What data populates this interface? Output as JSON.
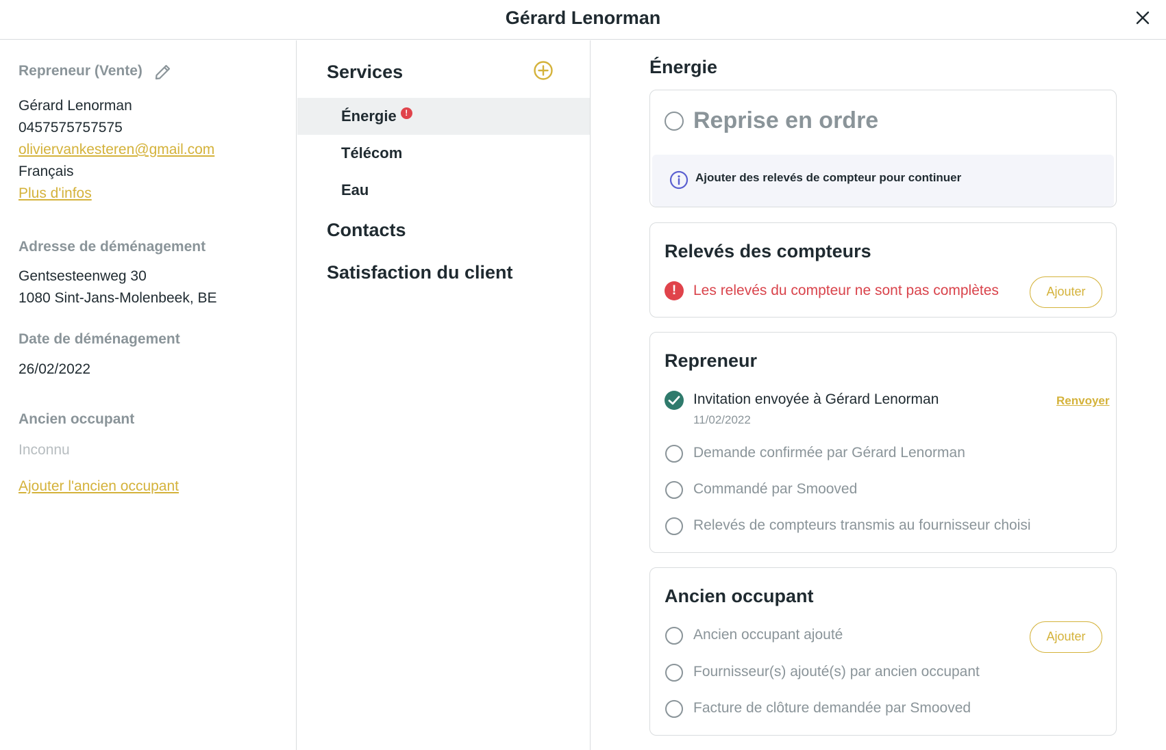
{
  "header": {
    "title": "Gérard Lenorman"
  },
  "left": {
    "repreneur_label": "Repreneur (Vente)",
    "name": "Gérard Lenorman",
    "phone": "0457575757575",
    "email": "oliviervankesteren@gmail.com",
    "language": "Français",
    "more_info": "Plus d'infos",
    "address_label": "Adresse de déménagement",
    "address_line1": "Gentsesteenweg 30",
    "address_line2": "1080 Sint-Jans-Molenbeek, BE",
    "date_label": "Date de déménagement",
    "date": "26/02/2022",
    "former_label": "Ancien occupant",
    "former_value": "Inconnu",
    "add_former": "Ajouter l'ancien occupant"
  },
  "middle": {
    "services_label": "Services",
    "services": [
      {
        "label": "Énergie",
        "active": true,
        "error": true
      },
      {
        "label": "Télécom",
        "active": false,
        "error": false
      },
      {
        "label": "Eau",
        "active": false,
        "error": false
      }
    ],
    "contacts_label": "Contacts",
    "satisfaction_label": "Satisfaction du client"
  },
  "right": {
    "section_title": "Énergie",
    "reprise": {
      "title": "Reprise en ordre",
      "info": "Ajouter des relevés de compteur pour continuer"
    },
    "meters": {
      "title": "Relevés des compteurs",
      "error": "Les relevés du compteur ne sont pas complètes",
      "add_label": "Ajouter"
    },
    "repreneur": {
      "title": "Repreneur",
      "resend_label": "Renvoyer",
      "steps": [
        {
          "label": "Invitation envoyée à Gérard Lenorman",
          "date": "11/02/2022",
          "done": true
        },
        {
          "label": "Demande confirmée par Gérard Lenorman",
          "done": false
        },
        {
          "label": "Commandé par Smooved",
          "done": false
        },
        {
          "label": "Relevés de compteurs transmis au fournisseur choisi",
          "done": false
        }
      ]
    },
    "former": {
      "title": "Ancien occupant",
      "add_label": "Ajouter",
      "steps": [
        {
          "label": "Ancien occupant ajouté",
          "done": false
        },
        {
          "label": "Fournisseur(s) ajouté(s) par ancien occupant",
          "done": false
        },
        {
          "label": "Facture de clôture demandée par Smooved",
          "done": false
        }
      ]
    }
  },
  "colors": {
    "accent": "#d4b23a",
    "error": "#e0434b",
    "success": "#2f7a6c",
    "info": "#5a5fd0",
    "muted": "#8a9499"
  },
  "icons": {
    "close": "close-icon",
    "edit": "pencil-icon",
    "add": "plus-circle-icon",
    "info": "info-icon",
    "error": "exclamation-icon",
    "done": "check-circle-icon"
  }
}
